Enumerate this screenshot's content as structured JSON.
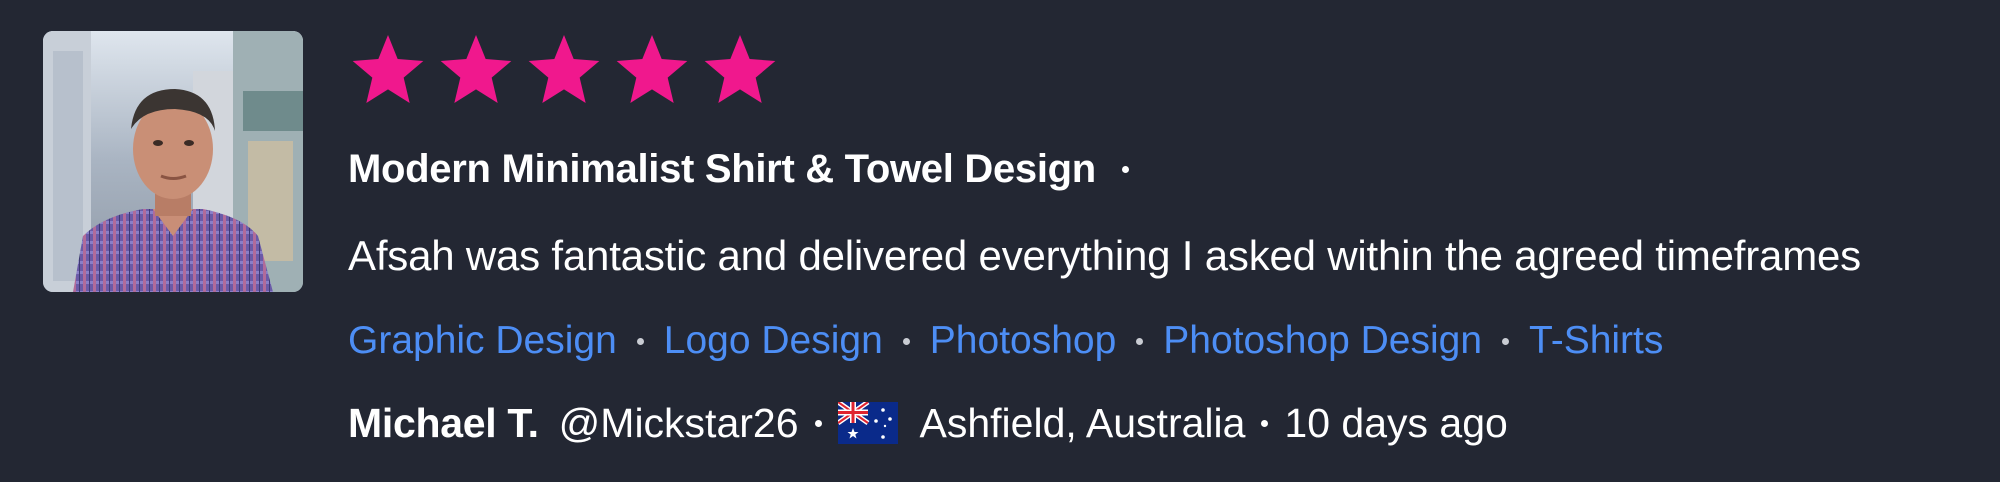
{
  "review": {
    "rating": {
      "value": 5,
      "max": 5,
      "star_color": "#f0188d"
    },
    "avatar": {
      "alt": "Michael T. profile photo"
    },
    "project_title": "Modern Minimalist Shirt & Towel Design",
    "comment": "Afsah was fantastic and delivered everything I asked within the agreed timeframes",
    "tags": [
      "Graphic Design",
      "Logo Design",
      "Photoshop",
      "Photoshop Design",
      "T-Shirts"
    ],
    "author": {
      "name": "Michael T.",
      "handle": "@Mickstar26",
      "country_flag": "australia-flag-icon",
      "location": "Ashfield, Australia"
    },
    "time_ago": "10 days ago"
  },
  "colors": {
    "background": "#232733",
    "tag_link": "#4d8ef5",
    "text": "#ffffff"
  }
}
